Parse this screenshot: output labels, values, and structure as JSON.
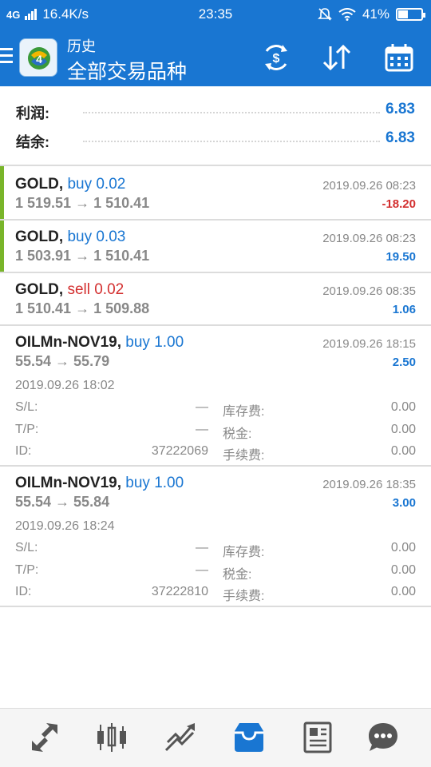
{
  "status_bar": {
    "signal": "4G",
    "speed": "16.4K/s",
    "time": "23:35",
    "battery": "41%",
    "battery_level": 0.41
  },
  "header": {
    "subtitle": "历史",
    "title": "全部交易品种"
  },
  "summary": {
    "profit_label": "利润:",
    "profit_value": "6.83",
    "balance_label": "结余:",
    "balance_value": "6.83"
  },
  "trades": [
    {
      "symbol": "GOLD,",
      "side": "buy 0.02",
      "prices": "1 519.51 → 1 510.41",
      "date": "2019.09.26 08:23",
      "profit": "-18.20"
    },
    {
      "symbol": "GOLD,",
      "side": "buy 0.03",
      "prices": "1 503.91 → 1 510.41",
      "date": "2019.09.26 08:23",
      "profit": "19.50"
    },
    {
      "symbol": "GOLD,",
      "side": "sell 0.02",
      "prices": "1 510.41 → 1 509.88",
      "date": "2019.09.26 08:35",
      "profit": "1.06"
    },
    {
      "symbol": "OILMn-NOV19,",
      "side": "buy 1.00",
      "prices": "55.54 → 55.79",
      "date": "2019.09.26 18:15",
      "profit": "2.50",
      "open_time": "2019.09.26 18:02",
      "sl_label": "S/L:",
      "sl_value": "—",
      "swap_label": "库存费:",
      "swap_value": "0.00",
      "tp_label": "T/P:",
      "tp_value": "—",
      "tax_label": "税金:",
      "tax_value": "0.00",
      "id_label": "ID:",
      "id_value": "37222069",
      "fee_label": "手续费:",
      "fee_value": "0.00"
    },
    {
      "symbol": "OILMn-NOV19,",
      "side": "buy 1.00",
      "prices": "55.54 → 55.84",
      "date": "2019.09.26 18:35",
      "profit": "3.00",
      "open_time": "2019.09.26 18:24",
      "sl_label": "S/L:",
      "sl_value": "—",
      "swap_label": "库存费:",
      "swap_value": "0.00",
      "tp_label": "T/P:",
      "tp_value": "—",
      "tax_label": "税金:",
      "tax_value": "0.00",
      "id_label": "ID:",
      "id_value": "37222810",
      "fee_label": "手续费:",
      "fee_value": "0.00"
    }
  ],
  "colors": {
    "primary": "#1976d2",
    "buy": "#1976d2",
    "sell": "#d32f2f",
    "profit_positive": "#1976d2",
    "profit_negative": "#d32f2f",
    "accent_bar": "#79b52a"
  },
  "bottom_nav": [
    "quotes-icon",
    "chart-icon",
    "trade-icon",
    "history-icon",
    "news-icon",
    "chat-icon"
  ]
}
